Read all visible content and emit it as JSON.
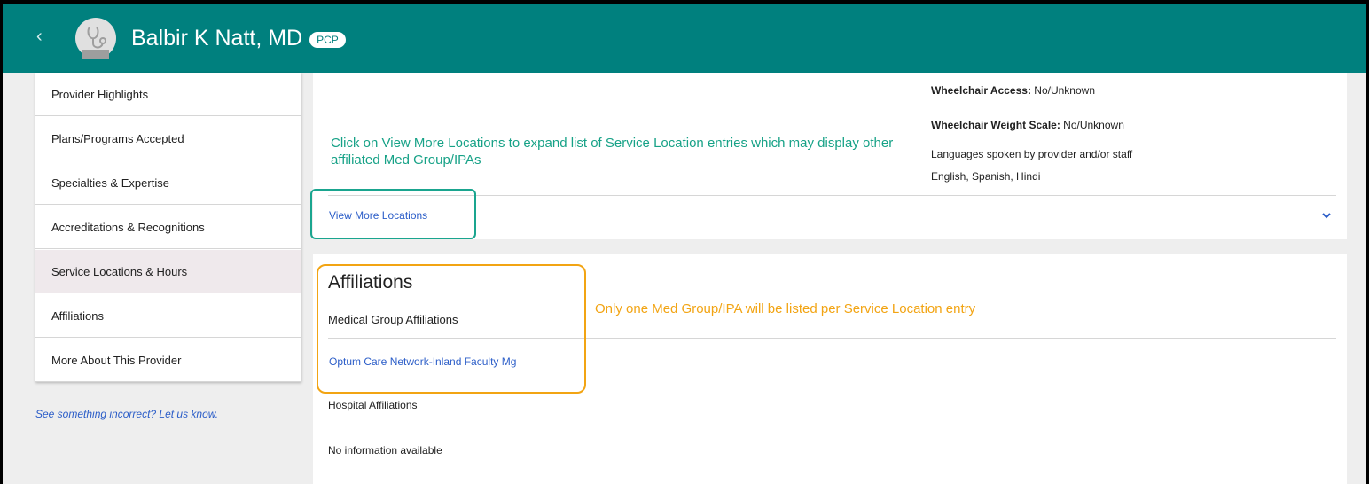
{
  "header": {
    "back_icon": "chevron-left-icon",
    "avatar_icon": "stethoscope-icon",
    "provider_name": "Balbir K Natt, MD",
    "badge": "PCP",
    "colors": {
      "header_bg": "#00807e",
      "badge_text": "#00807e"
    }
  },
  "sidebar": {
    "items": [
      {
        "label": "Provider Highlights",
        "active": false
      },
      {
        "label": "Plans/Programs Accepted",
        "active": false
      },
      {
        "label": "Specialties & Expertise",
        "active": false
      },
      {
        "label": "Accreditations & Recognitions",
        "active": false
      },
      {
        "label": "Service Locations & Hours",
        "active": true
      },
      {
        "label": "Affiliations",
        "active": false
      },
      {
        "label": "More About This Provider",
        "active": false
      }
    ],
    "feedback_link": "See something incorrect? Let us know."
  },
  "location": {
    "wheelchair_access_label": "Wheelchair Access:",
    "wheelchair_access_value": "No/Unknown",
    "wheelchair_scale_label": "Wheelchair Weight Scale:",
    "wheelchair_scale_value": "No/Unknown",
    "languages_label": "Languages spoken by provider and/or staff",
    "languages_value": "English, Spanish, Hindi",
    "view_more_link": "View More Locations",
    "expand_icon": "chevron-down-icon"
  },
  "affiliations": {
    "title": "Affiliations",
    "medical_group_label": "Medical Group Affiliations",
    "medical_group_value": "Optum Care Network-Inland Faculty Mg",
    "hospital_label": "Hospital Affiliations",
    "hospital_value": "No information available"
  },
  "annotations": {
    "note_1": "Click on View More Locations to expand list of Service Location entries which may display other affiliated Med Group/IPAs",
    "note_2": "Only one Med Group/IPA will be listed per Service Location entry",
    "colors": {
      "note_1": "#17a287",
      "note_2": "#f2a413"
    }
  },
  "colors": {
    "link": "#2b5dc8",
    "page_bg": "#eeeeee"
  }
}
